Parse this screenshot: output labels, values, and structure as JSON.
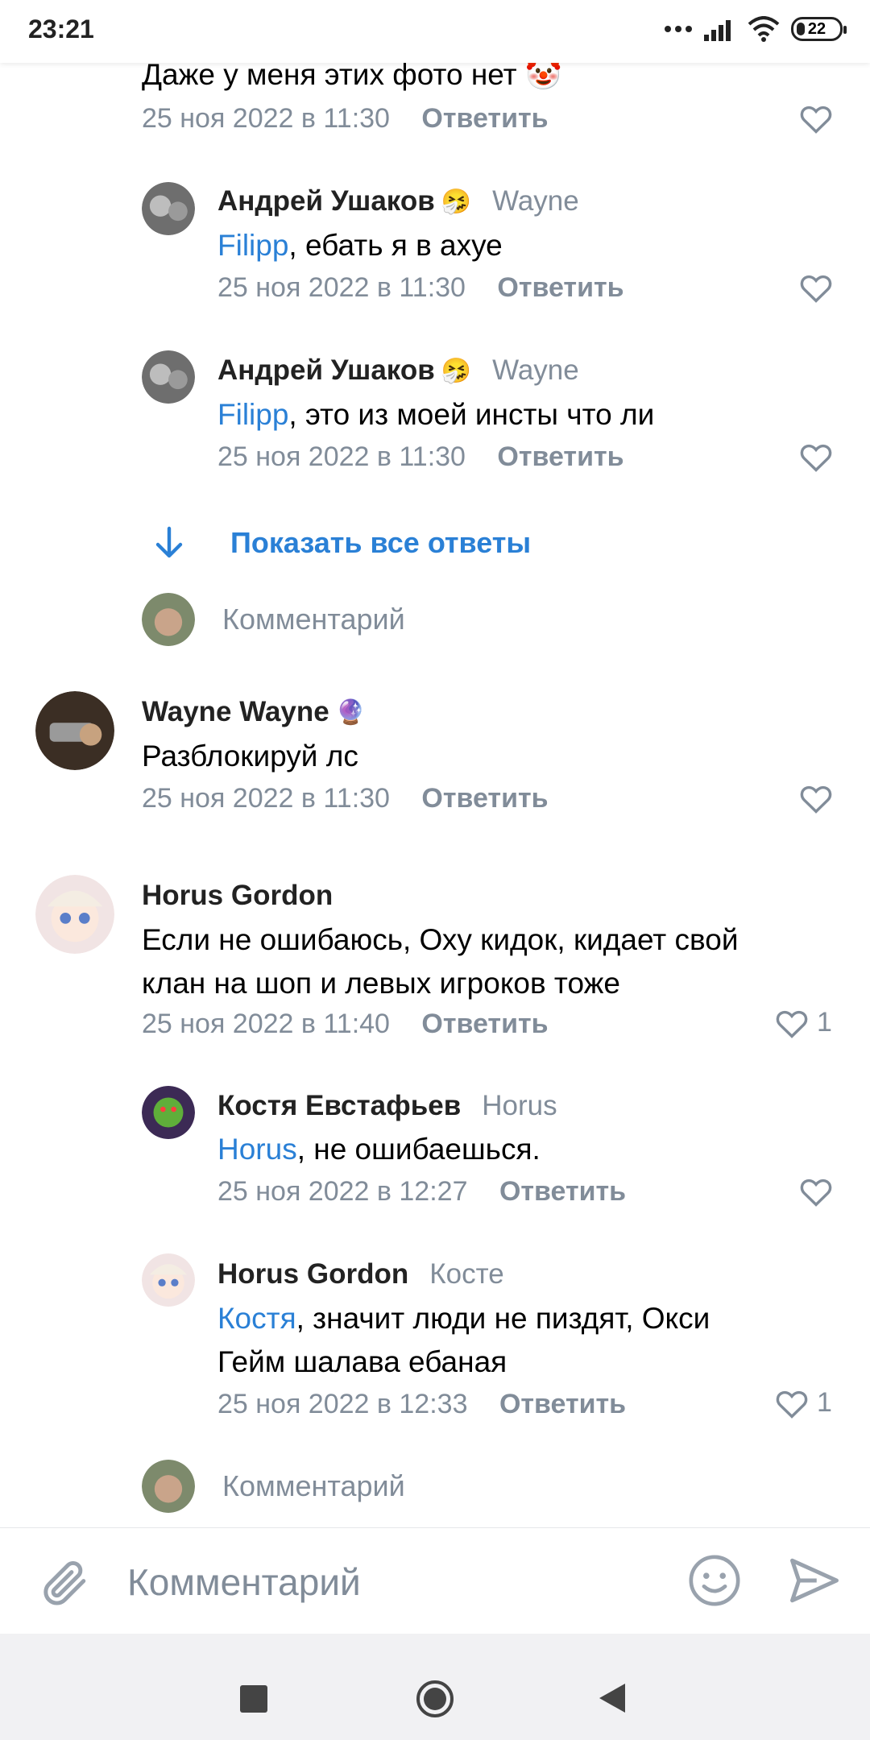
{
  "status_bar": {
    "time": "23:21",
    "battery": "22"
  },
  "comments": [
    {
      "author": "",
      "text": "Даже у меня этих фото нет",
      "emoji": "🤡",
      "date": "25 ноя 2022 в 11:30",
      "reply_label": "Ответить",
      "likes": ""
    },
    {
      "author": "Андрей Ушаков",
      "author_emoji": "🤧",
      "reply_to": "Wayne",
      "mention": "Filipp",
      "text": ", ебать я в ахуе",
      "date": "25 ноя 2022 в 11:30",
      "reply_label": "Ответить",
      "likes": ""
    },
    {
      "author": "Андрей Ушаков",
      "author_emoji": "🤧",
      "reply_to": "Wayne",
      "mention": "Filipp",
      "text": ", это из моей инсты что ли",
      "date": "25 ноя 2022 в 11:30",
      "reply_label": "Ответить",
      "likes": ""
    },
    {
      "author": "Wayne Wayne",
      "author_emoji": "🔮",
      "text": "Разблокируй лс",
      "date": "25 ноя 2022 в 11:30",
      "reply_label": "Ответить",
      "likes": ""
    },
    {
      "author": "Horus Gordon",
      "text_line1": "Если не ошибаюсь, Оху кидок, кидает свой",
      "text_line2": "клан на шоп и левых игроков тоже",
      "date": "25 ноя 2022 в 11:40",
      "reply_label": "Ответить",
      "likes": "1"
    },
    {
      "author": "Костя Евстафьев",
      "reply_to": "Horus",
      "mention": "Horus",
      "text": ", не ошибаешься.",
      "date": "25 ноя 2022 в 12:27",
      "reply_label": "Ответить",
      "likes": ""
    },
    {
      "author": "Horus Gordon",
      "reply_to": "Косте",
      "mention": "Костя",
      "text_line1": ", значит люди не пиздят, Окси",
      "text_line2": "Гейм шалава ебаная",
      "date": "25 ноя 2022 в 12:33",
      "reply_label": "Ответить",
      "likes": "1"
    }
  ],
  "show_all_replies": "Показать все ответы",
  "comment_placeholder": "Комментарий",
  "input_bar": {
    "placeholder": "Комментарий"
  },
  "colors": {
    "accent": "#2a80d6",
    "secondary_text": "#818c99"
  }
}
